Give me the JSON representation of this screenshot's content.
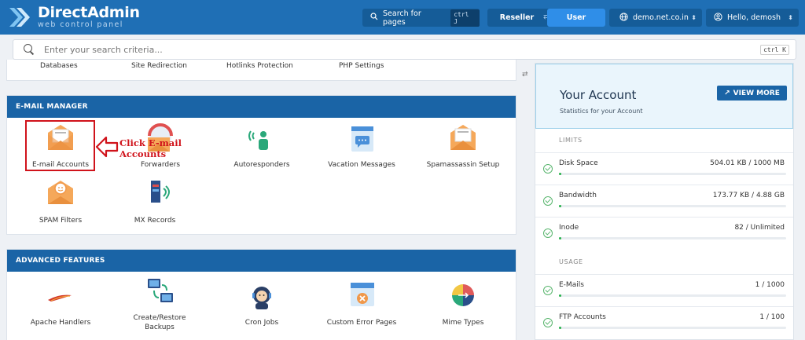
{
  "topbar": {
    "logo_title": "DirectAdmin",
    "logo_subtitle": "web control panel",
    "search_label": "Search for pages",
    "search_shortcut": "ctrl J",
    "role_reseller": "Reseller",
    "role_user": "User",
    "domain": "demo.net.co.in",
    "greeting": "Hello, demosh"
  },
  "search": {
    "placeholder": "Enter your search criteria...",
    "shortcut": "ctrl K"
  },
  "top_strip": {
    "items": [
      "Databases",
      "Site Redirection",
      "Hotlinks Protection",
      "PHP Settings"
    ]
  },
  "email_manager": {
    "title": "E-MAIL MANAGER",
    "tiles": [
      {
        "label": "E-mail Accounts",
        "icon": "envelope-icon"
      },
      {
        "label": "Forwarders",
        "icon": "forward-mail-icon"
      },
      {
        "label": "Autoresponders",
        "icon": "autoresponder-icon"
      },
      {
        "label": "Vacation Messages",
        "icon": "vacation-message-icon"
      },
      {
        "label": "Spamassassin Setup",
        "icon": "spam-envelope-icon"
      },
      {
        "label": "SPAM Filters",
        "icon": "spam-filter-icon"
      },
      {
        "label": "MX Records",
        "icon": "mx-records-icon"
      }
    ]
  },
  "annotation": {
    "line1": "Click E-mail",
    "line2": "Accounts"
  },
  "advanced_features": {
    "title": "ADVANCED FEATURES",
    "tiles": [
      {
        "label": "Apache Handlers",
        "icon": "feather-icon"
      },
      {
        "label": "Create/Restore",
        "label2": "Backups",
        "icon": "backup-icon"
      },
      {
        "label": "Cron Jobs",
        "icon": "cron-robot-icon"
      },
      {
        "label": "Custom Error Pages",
        "icon": "error-page-icon"
      },
      {
        "label": "Mime Types",
        "icon": "mime-types-icon"
      }
    ]
  },
  "account": {
    "title": "Your Account",
    "subtitle": "Statistics for your Account",
    "view_more": "VIEW MORE",
    "limits_label": "LIMITS",
    "usage_label": "USAGE",
    "limits": [
      {
        "label": "Disk Space",
        "value": "504.01 KB / 1000 MB",
        "fraction": 0.005
      },
      {
        "label": "Bandwidth",
        "value": "173.77 KB / 4.88 GB",
        "fraction": 0.005
      },
      {
        "label": "Inode",
        "value": "82 / Unlimited",
        "fraction": 0.005
      }
    ],
    "usage": [
      {
        "label": "E-Mails",
        "value": "1 / 1000",
        "fraction": 0.005
      },
      {
        "label": "FTP Accounts",
        "value": "1 / 100",
        "fraction": 0.01
      }
    ]
  },
  "colors": {
    "brand": "#1f6fb5",
    "panel_header": "#1a64a6",
    "annotation": "#d0131b",
    "progress": "#27b24a"
  }
}
